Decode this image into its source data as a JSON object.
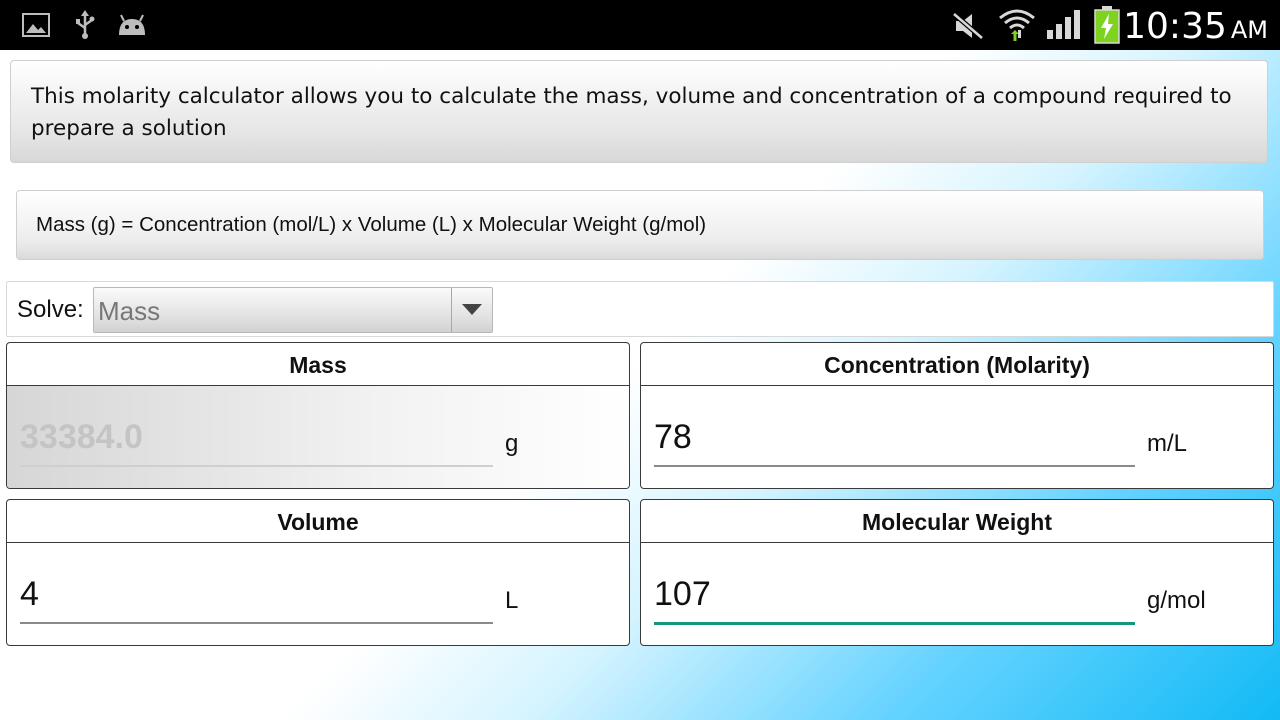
{
  "status_bar": {
    "time": "10:35",
    "ampm": "AM",
    "icons": [
      "gallery-icon",
      "usb-icon",
      "android-debug-icon",
      "mute-icon",
      "wifi-icon",
      "signal-icon",
      "battery-charging-icon"
    ]
  },
  "info": {
    "description": "This molarity calculator allows you to calculate the mass, volume and concentration of a compound required to prepare a solution"
  },
  "formula": {
    "text": "Mass (g) = Concentration (mol/L) x Volume (L) x Molecular Weight (g/mol)"
  },
  "solve": {
    "label": "Solve:",
    "selected": "Mass"
  },
  "fields": {
    "mass": {
      "title": "Mass",
      "value": "33384.0",
      "unit": "g"
    },
    "concentration": {
      "title": "Concentration (Molarity)",
      "value": "78",
      "unit": "m/L"
    },
    "volume": {
      "title": "Volume",
      "value": "4",
      "unit": "L"
    },
    "molecular_weight": {
      "title": "Molecular Weight",
      "value": "107",
      "unit": "g/mol"
    }
  },
  "colors": {
    "status_bar": "#000000",
    "active_underline": "#17967f",
    "battery_green": "#7ed321",
    "gradient_blue": "#12baf6"
  }
}
